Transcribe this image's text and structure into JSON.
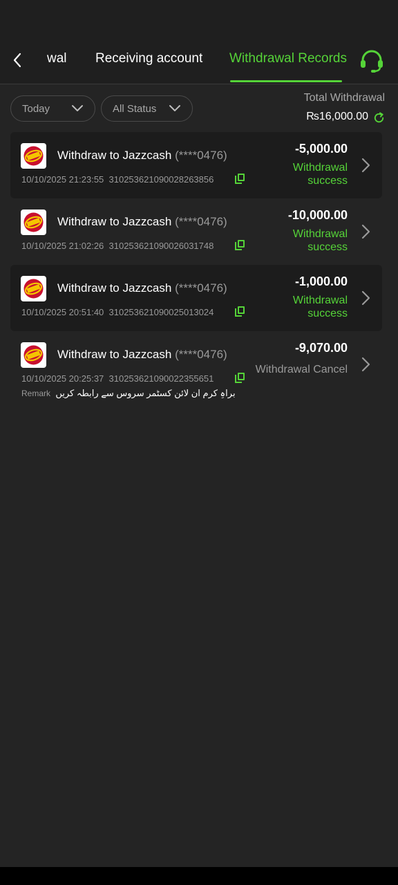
{
  "tabs": {
    "partial_label": "wal",
    "receiving_label": "Receiving account",
    "records_label": "Withdrawal Records"
  },
  "filters": {
    "date_value": "Today",
    "status_value": "All Status"
  },
  "total": {
    "label": "Total Withdrawal",
    "value": "₨16,000.00"
  },
  "records": [
    {
      "title": "Withdraw to Jazzcash",
      "account_masked": "(****0476)",
      "datetime": "10/10/2025 21:23:55",
      "order_id": "310253621090028263856",
      "amount": "-5,000.00",
      "status": "Withdrawal success"
    },
    {
      "title": "Withdraw to Jazzcash",
      "account_masked": "(****0476)",
      "datetime": "10/10/2025 21:02:26",
      "order_id": "310253621090026031748",
      "amount": "-10,000.00",
      "status": "Withdrawal success"
    },
    {
      "title": "Withdraw to Jazzcash",
      "account_masked": "(****0476)",
      "datetime": "10/10/2025 20:51:40",
      "order_id": "310253621090025013024",
      "amount": "-1,000.00",
      "status": "Withdrawal success"
    },
    {
      "title": "Withdraw to Jazzcash",
      "account_masked": "(****0476)",
      "datetime": "10/10/2025 20:25:37",
      "order_id": "310253621090022355651",
      "amount": "-9,070.00",
      "status": "Withdrawal Cancel",
      "remark_label": "Remark",
      "remark_text": "براہِ کرم ان لائن کسٹمر سروس سے رابطہ کریں"
    }
  ],
  "colors": {
    "accent": "#55d338",
    "background": "#242424",
    "card": "#1c1c1c",
    "muted_text": "#9a9a9a"
  },
  "icons": {
    "back": "chevron-left-icon",
    "support": "headset-icon",
    "filter": "chevron-down-icon",
    "refresh": "refresh-icon",
    "copy": "copy-icon",
    "record_detail": "chevron-right-icon",
    "provider_logo": "jazz-logo"
  }
}
